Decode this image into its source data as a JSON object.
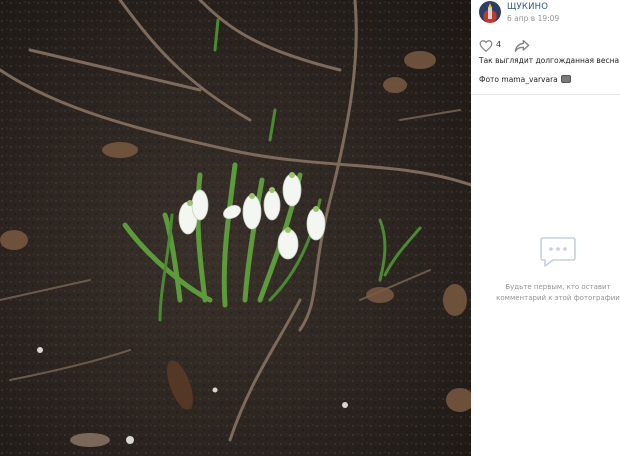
{
  "photo": {
    "subject": "snowdrops-photo",
    "colors": {
      "soil": "#2b2420",
      "petal": "#f4f6f2",
      "leaf": "#5d9a3c"
    }
  },
  "post": {
    "author": "ЩУКИНО",
    "date": "6 апр в 19:09",
    "likes": "4",
    "caption": "Так выглядит долгожданная весна",
    "credit": "Фото mama_varvara"
  },
  "comments": {
    "empty_line1": "Будьте первым, кто оставит",
    "empty_line2": "комментарий к этой фотографии"
  },
  "colors": {
    "link": "#2a5885",
    "muted": "#939393",
    "divider": "#e7e8ec"
  }
}
